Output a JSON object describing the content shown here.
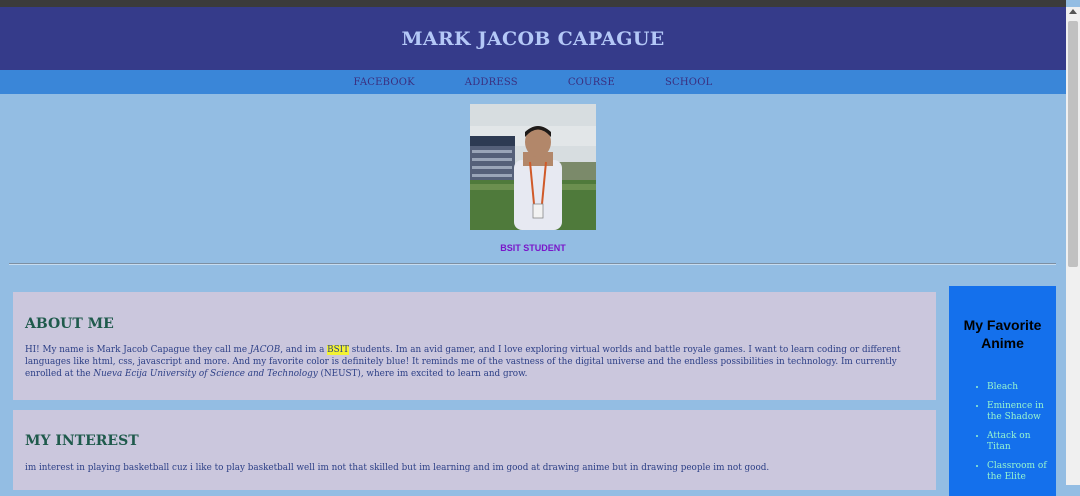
{
  "header": {
    "title": "MARK JACOB CAPAGUE"
  },
  "nav": {
    "items": [
      "FACEBOOK",
      "ADDRESS",
      "COURSE",
      "SCHOOL"
    ]
  },
  "profile": {
    "caption": "BSIT STUDENT"
  },
  "about": {
    "title": "ABOUT ME",
    "t1": "HI! My name is Mark Jacob Capague they call me ",
    "nickname": "JACOB",
    "t2": ", and im a ",
    "highlight": "BSIT",
    "t3": " students. Im an avid gamer, and I love exploring virtual worlds and battle royale games. I want to learn coding or different languages like html, css, javascript and more. And my favorite color is definitely blue! It reminds me of the vastness of the digital universe and the endless possibilities in technology. Im currently enrolled at the ",
    "school": "Nueva Ecija University of Science and Technology",
    "t4": " (NEUST), where im excited to learn and grow."
  },
  "interest": {
    "title": "MY INTEREST",
    "text": "im interest in playing basketball cuz i like to play basketball well im not that skilled but im learning and im good at drawing anime but in drawing people im not good."
  },
  "sidebar": {
    "title": "My Favorite Anime",
    "items": [
      "Bleach",
      "Eminence in the Shadow",
      "Attack on Titan",
      "Classroom of the Elite"
    ]
  },
  "colors": {
    "header_bg": "#353b8a",
    "nav_bg": "#3a86d8",
    "page_bg": "#93bde3",
    "card_bg": "#cbc7dd",
    "sidebar_bg": "#1470ec",
    "highlight": "#f3f233"
  }
}
